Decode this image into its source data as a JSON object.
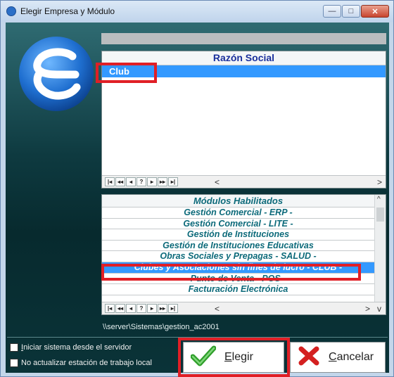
{
  "window": {
    "title": "Elegir Empresa y Módulo",
    "min_glyph": "—",
    "max_glyph": "□",
    "close_glyph": "✕"
  },
  "empresa_grid": {
    "header": "Razón Social",
    "rows": [
      "Club"
    ],
    "selected_index": 0
  },
  "navigator": {
    "buttons": [
      "|◂",
      "◂◂",
      "◂",
      "?",
      "▸",
      "▸▸",
      "▸|"
    ],
    "scroll_left": "<",
    "scroll_right": ">"
  },
  "modules_grid": {
    "header": "Módulos Habilitados",
    "rows": [
      "Gestión Comercial - ERP -",
      "Gestión Comercial - LITE -",
      "Gestión de Instituciones",
      "Gestión de Instituciones Educativas",
      "Obras Sociales y Prepagas - SALUD -",
      "Clubes y Asociaciones sin fines de lucro - CLUB -",
      "Punto de Venta - POS -",
      "Facturación Electrónica"
    ],
    "selected_index": 5,
    "scroll_up": "^",
    "scroll_down": "v"
  },
  "server_path": "\\\\server\\Sistemas\\gestion_ac2001",
  "options": {
    "start_from_server": {
      "label_underlined": "I",
      "label_rest": "niciar sistema desde el servidor",
      "checked": false
    },
    "no_update_local": {
      "label": "No actualizar estación de trabajo local",
      "checked": false
    }
  },
  "buttons": {
    "elegir": {
      "label_underlined": "E",
      "label_rest": "legir",
      "icon": "checkmark-icon"
    },
    "cancelar": {
      "label_underlined": "C",
      "label_rest": "ancelar",
      "icon": "x-icon"
    }
  },
  "colors": {
    "highlight": "#e01f26",
    "selection": "#3399ff",
    "module_text": "#0c6a7a"
  }
}
